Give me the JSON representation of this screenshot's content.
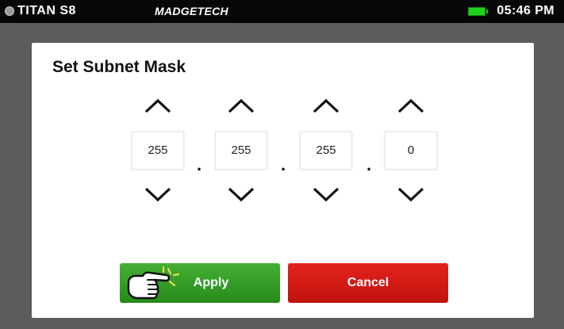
{
  "status_bar": {
    "device_name": "TITAN S8",
    "brand": "MADGETECH",
    "time": "05:46 PM"
  },
  "icons": {
    "status": "status-dot-icon",
    "battery": "battery-icon",
    "increment": "chevron-up-icon",
    "decrement": "chevron-down-icon",
    "pointer": "pointing-hand-icon"
  },
  "colors": {
    "status_bar_bg": "#070707",
    "apply_green": "#2f9a22",
    "cancel_red": "#d3180f",
    "battery_green": "#1fd11f"
  },
  "dialog": {
    "title": "Set Subnet Mask",
    "octets": [
      "255",
      "255",
      "255",
      "0"
    ],
    "separator": ".",
    "apply_label": "Apply",
    "cancel_label": "Cancel"
  }
}
